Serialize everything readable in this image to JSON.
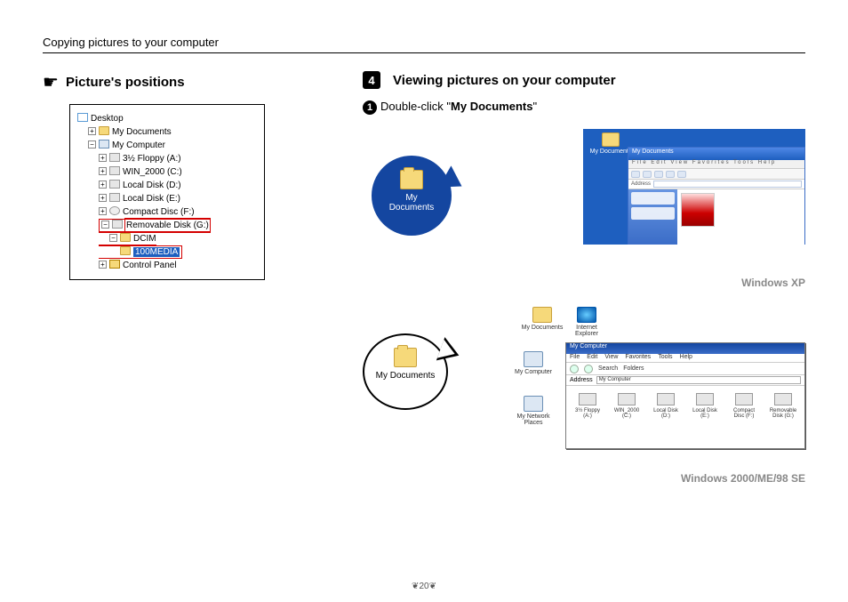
{
  "page": {
    "header": "Copying pictures to your computer",
    "number": "20"
  },
  "left": {
    "heading": "Picture's positions",
    "tree": {
      "desktop": "Desktop",
      "mydocs": "My Documents",
      "mycomp": "My Computer",
      "floppy": "3½ Floppy (A:)",
      "win2000": "WIN_2000 (C:)",
      "localD": "Local Disk (D:)",
      "localE": "Local Disk (E:)",
      "cd": "Compact Disc (F:)",
      "removable": "Removable Disk (G:)",
      "dcim": "DCIM",
      "media": "100MEDIA",
      "control": "Control Panel"
    }
  },
  "right": {
    "step_number": "4",
    "heading": "Viewing pictures on your computer",
    "sub_number": "1",
    "instruction_prefix": "Double-click \"",
    "instruction_bold": "My Documents",
    "instruction_suffix": "\"",
    "bubble_label": "My Documents",
    "os_xp": "Windows XP",
    "os_2k": "Windows 2000/ME/98 SE",
    "xp_window": {
      "title": "My Documents",
      "menu": "File  Edit  View  Favorites  Tools  Help",
      "address_label": "Address"
    },
    "desktop_icons": {
      "mydocs": "My Documents",
      "mycomp": "My Computer",
      "ie": "Internet Explorer",
      "network": "My Network Places"
    },
    "win2k": {
      "title": "My Computer",
      "menu": [
        "File",
        "Edit",
        "View",
        "Favorites",
        "Tools",
        "Help"
      ],
      "toolbar": {
        "search": "Search",
        "folders": "Folders"
      },
      "address_label": "Address",
      "address_value": "My Computer",
      "drives": [
        "3½ Floppy (A:)",
        "WIN_2000 (C:)",
        "Local Disk (D:)",
        "Local Disk (E:)",
        "Compact Disc (F:)",
        "Removable Disk (G:)"
      ]
    }
  }
}
